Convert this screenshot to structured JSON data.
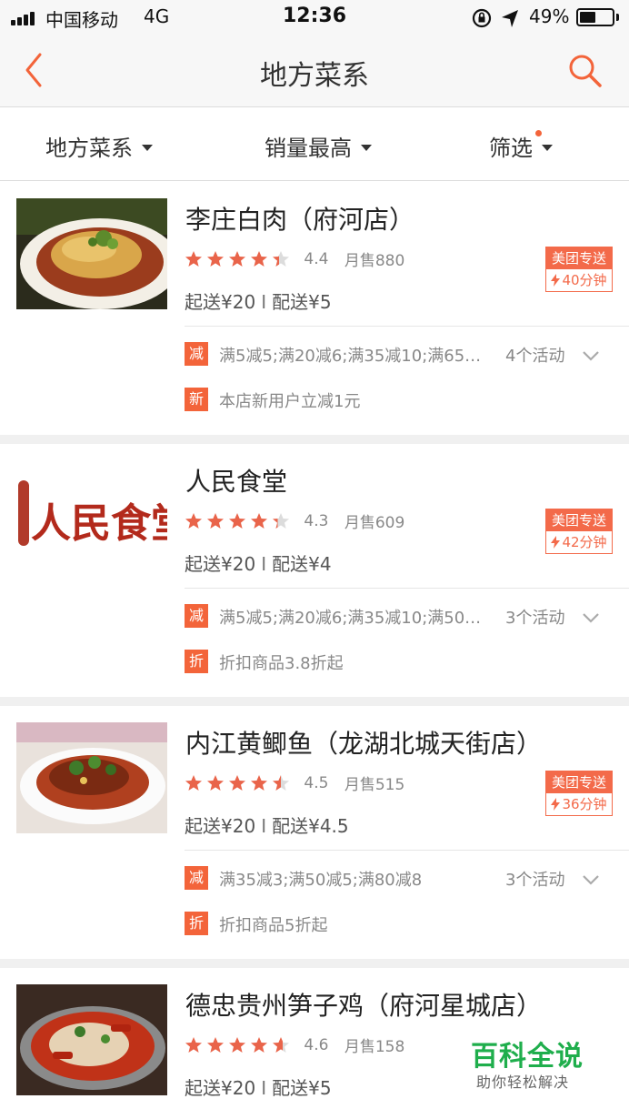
{
  "status_bar": {
    "carrier": "中国移动",
    "network": "4G",
    "time": "12:36",
    "battery_percent": "49%",
    "battery_level": 0.49,
    "icons": [
      "rotation-lock-icon",
      "location-arrow-icon"
    ]
  },
  "nav": {
    "title": "地方菜系",
    "back_icon": "back-chevron-icon",
    "search_icon": "search-icon",
    "accent_color": "#f3643a"
  },
  "filters": [
    {
      "label": "地方菜系"
    },
    {
      "label": "销量最高"
    },
    {
      "label": "筛选"
    }
  ],
  "restaurants": [
    {
      "name": "李庄白肉（府河店）",
      "rating": 4.4,
      "rating_text": "4.4",
      "sales": "月售880",
      "min_order": "起送¥20",
      "delivery_fee": "配送¥5",
      "badge": {
        "label": "美团专送",
        "time": "40分钟"
      },
      "promotions": [
        {
          "tag": "减",
          "tag_color": "#f3643a",
          "text": "满5减5;满20减6;满35减10;满65…",
          "activity": "4个活动"
        },
        {
          "tag": "新",
          "tag_color": "#f3643a",
          "text": "本店新用户立减1元"
        }
      ]
    },
    {
      "name": "人民食堂",
      "rating": 4.3,
      "rating_text": "4.3",
      "sales": "月售609",
      "min_order": "起送¥20",
      "delivery_fee": "配送¥4",
      "badge": {
        "label": "美团专送",
        "time": "42分钟"
      },
      "logo_text": "人民食堂",
      "promotions": [
        {
          "tag": "减",
          "tag_color": "#f3643a",
          "text": "满5减5;满20减6;满35减10;满50…",
          "activity": "3个活动"
        },
        {
          "tag": "折",
          "tag_color": "#f3643a",
          "text": "折扣商品3.8折起"
        }
      ]
    },
    {
      "name": "内江黄鲫鱼（龙湖北城天街店）",
      "rating": 4.5,
      "rating_text": "4.5",
      "sales": "月售515",
      "min_order": "起送¥20",
      "delivery_fee": "配送¥4.5",
      "badge": {
        "label": "美团专送",
        "time": "36分钟"
      },
      "promotions": [
        {
          "tag": "减",
          "tag_color": "#f3643a",
          "text": "满35减3;满50减5;满80减8",
          "activity": "3个活动"
        },
        {
          "tag": "折",
          "tag_color": "#f3643a",
          "text": "折扣商品5折起"
        }
      ]
    },
    {
      "name": "德忠贵州笋子鸡（府河星城店）",
      "rating": 4.6,
      "rating_text": "4.6",
      "sales": "月售158",
      "min_order": "起送¥20",
      "delivery_fee": "配送¥5",
      "promotions": []
    }
  ],
  "watermark": {
    "title": "百科全说",
    "subtitle": "助你轻松解决"
  }
}
